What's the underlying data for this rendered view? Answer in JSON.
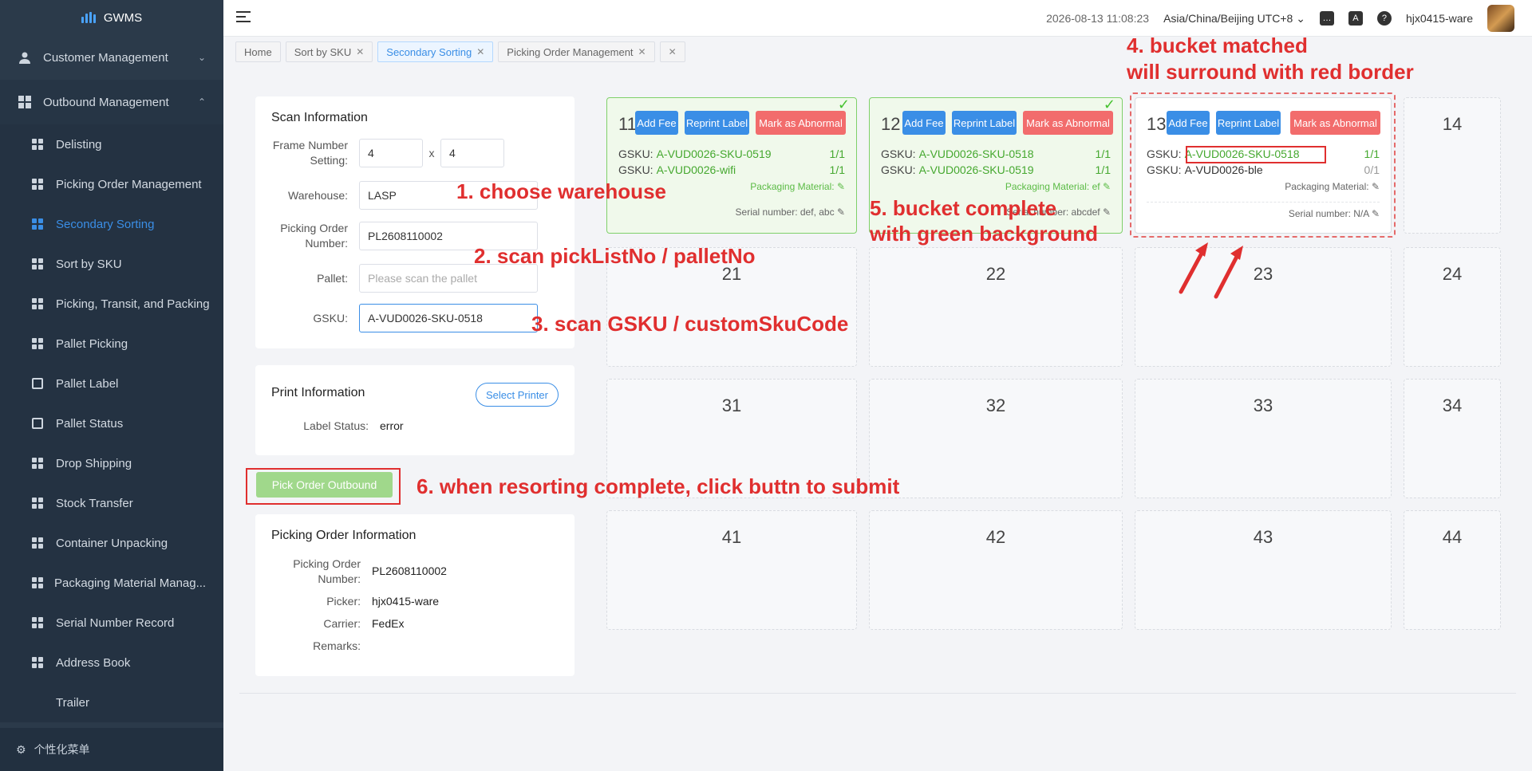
{
  "app": {
    "name": "GWMS"
  },
  "sidebar": {
    "groups": [
      {
        "label": "Customer Management"
      },
      {
        "label": "Outbound Management"
      }
    ],
    "items": [
      {
        "label": "Delisting"
      },
      {
        "label": "Picking Order Management"
      },
      {
        "label": "Secondary Sorting"
      },
      {
        "label": "Sort by SKU"
      },
      {
        "label": "Picking, Transit, and Packing"
      },
      {
        "label": "Pallet Picking"
      },
      {
        "label": "Pallet Label"
      },
      {
        "label": "Pallet Status"
      },
      {
        "label": "Drop Shipping"
      },
      {
        "label": "Stock Transfer"
      },
      {
        "label": "Container Unpacking"
      },
      {
        "label": "Packaging Material Manag..."
      },
      {
        "label": "Serial Number Record"
      },
      {
        "label": "Address Book"
      },
      {
        "label": "Trailer"
      }
    ],
    "footer": "个性化菜单"
  },
  "header": {
    "datetime": "2026-08-13 11:08:23",
    "timezone": "Asia/China/Beijing UTC+8",
    "user": "hjx0415-ware"
  },
  "tabs": [
    {
      "label": "Home"
    },
    {
      "label": "Sort by SKU"
    },
    {
      "label": "Secondary Sorting"
    },
    {
      "label": "Picking Order Management"
    }
  ],
  "scan": {
    "title": "Scan Information",
    "frame_label": "Frame Number Setting:",
    "frame_rows": "4",
    "frame_x": "x",
    "frame_cols": "4",
    "warehouse_label": "Warehouse:",
    "warehouse_value": "LASP",
    "picking_label": "Picking Order Number:",
    "picking_value": "PL2608110002",
    "pallet_label": "Pallet:",
    "pallet_placeholder": "Please scan the pallet",
    "gsku_label": "GSKU:",
    "gsku_value": "A-VUD0026-SKU-0518"
  },
  "print": {
    "title": "Print Information",
    "select_printer": "Select Printer",
    "label_status_label": "Label Status:",
    "label_status_value": "error"
  },
  "submit_label": "Pick Order Outbound",
  "order_info": {
    "title": "Picking Order Information",
    "number_label": "Picking Order Number:",
    "number_value": "PL2608110002",
    "picker_label": "Picker:",
    "picker_value": "hjx0415-ware",
    "carrier_label": "Carrier:",
    "carrier_value": "FedEx",
    "remarks_label": "Remarks:"
  },
  "bucket_buttons": {
    "add_fee": "Add Fee",
    "reprint": "Reprint Label",
    "abnormal": "Mark as Abnormal"
  },
  "buckets": {
    "b11": {
      "num": "11",
      "gsku_label": "GSKU:",
      "line1": "A-VUD0026-SKU-0519",
      "cnt1": "1/1",
      "line2": "A-VUD0026-wifi",
      "cnt2": "1/1",
      "pack": "Packaging Material:",
      "serial": "Serial number:  def, abc",
      "status": "complete"
    },
    "b12": {
      "num": "12",
      "gsku_label": "GSKU:",
      "line1": "A-VUD0026-SKU-0518",
      "cnt1": "1/1",
      "line2": "A-VUD0026-SKU-0519",
      "cnt2": "1/1",
      "pack": "Packaging Material:  ef",
      "serial": "Serial number:  abcdef",
      "status": "complete"
    },
    "b13": {
      "num": "13",
      "gsku_label": "GSKU:",
      "line1": "A-VUD0026-SKU-0518",
      "cnt1": "1/1",
      "line2": "A-VUD0026-ble",
      "cnt2": "0/1",
      "pack": "Packaging Material:",
      "serial": "Serial number:  N/A",
      "status": "matched"
    },
    "empty": [
      "14",
      "21",
      "22",
      "23",
      "24",
      "31",
      "32",
      "33",
      "34",
      "41",
      "42",
      "43",
      "44"
    ]
  },
  "annotations": {
    "a1": "1. choose warehouse",
    "a2": "2. scan pickListNo / palletNo",
    "a3": "3. scan GSKU / customSkuCode",
    "a4_l1": "4. bucket matched",
    "a4_l2": "will surround with red border",
    "a5_l1": "5. bucket complete",
    "a5_l2": "with green background",
    "a6": "6. when resorting complete, click buttn to submit"
  },
  "colors": {
    "accent": "#3a8ee6",
    "success": "#45a82f",
    "danger": "#e02f2f",
    "sidebar": "#2b3a4a"
  }
}
